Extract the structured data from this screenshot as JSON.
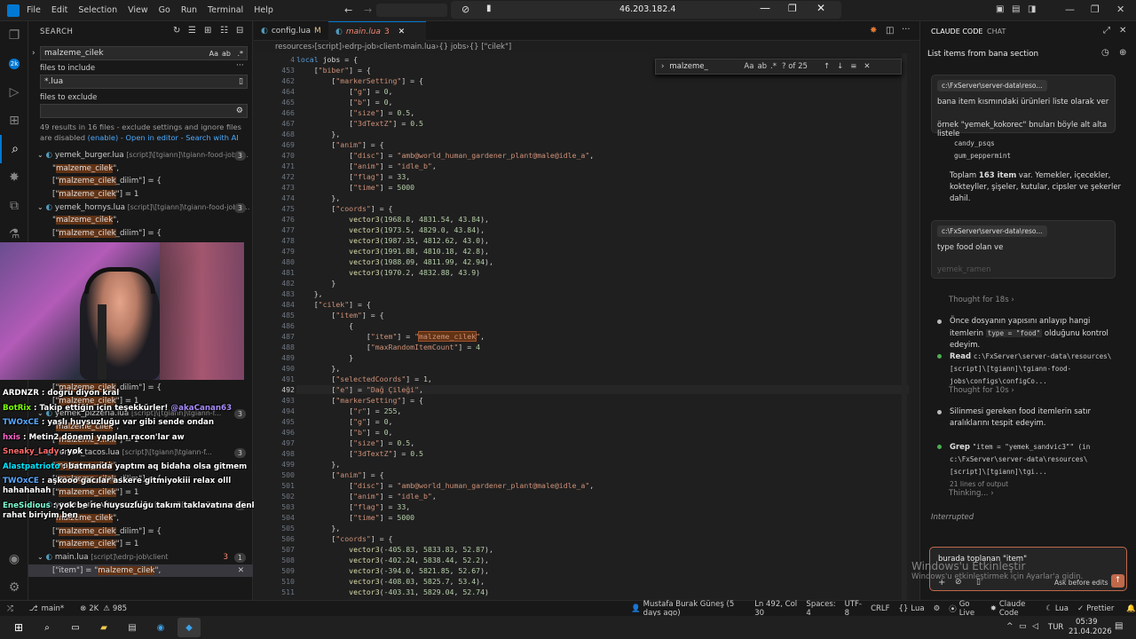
{
  "menu": [
    "File",
    "Edit",
    "Selection",
    "View",
    "Go",
    "Run",
    "Terminal",
    "Help"
  ],
  "remote_ip": "46.203.182.4",
  "search": {
    "header": "SEARCH",
    "query": "malzeme_cilek",
    "include_label": "files to include",
    "include_value": "*.lua",
    "exclude_label": "files to exclude",
    "summary": "49 results in 16 files - exclude settings and ignore files are disabled",
    "enable": "(enable)",
    "open_editor": "Open in editor",
    "search_ai": "Search with AI",
    "results": [
      {
        "type": "file",
        "name": "yemek_burger.lua",
        "path": "[script]\\[tgiann]\\tgiann-food-jobs\\...",
        "count": "3"
      },
      {
        "type": "match",
        "text": "\"malzeme_cilek\","
      },
      {
        "type": "match",
        "text": "[\"malzeme_cilek_dilim\"] = {"
      },
      {
        "type": "match",
        "text": "[\"malzeme_cilek\"] = 1"
      },
      {
        "type": "file",
        "name": "yemek_hornys.lua",
        "path": "[script]\\[tgiann]\\tgiann-food-jobs\\...",
        "count": "3"
      },
      {
        "type": "match",
        "text": "\"malzeme_cilek\","
      },
      {
        "type": "match",
        "text": "[\"malzeme_cilek_dilim\"] = {"
      }
    ],
    "results_bottom": [
      {
        "type": "match",
        "text": "[\"malzeme_cilek_dilim\"] = {"
      },
      {
        "type": "match",
        "text": "[\"malzeme_cilek\"] = 1"
      },
      {
        "type": "file",
        "name": "yemek_pizzeria.lua",
        "path": "[script]\\[tgiann]\\tgiann-f...",
        "count": "3"
      },
      {
        "type": "match",
        "text": "\"malzeme_cilek\","
      },
      {
        "type": "match",
        "text": "[\"malzeme_cilek\"] = 1"
      },
      {
        "type": "file",
        "name": "yemek_tacos.lua",
        "path": "[script]\\[tgiann]\\tgiann-f...",
        "count": "3"
      },
      {
        "type": "match",
        "text": "\"malzeme_cilek\","
      },
      {
        "type": "match",
        "text": "[\"malzeme_cilek_dilim\"] = {"
      },
      {
        "type": "match",
        "text": "[\"malzeme_cilek\"] = 1"
      },
      {
        "type": "file",
        "name": "yemek_ufo_vinewood.lua",
        "path": "[script]\\[tgiann]\\tgiann-foo...",
        "count": "3"
      },
      {
        "type": "match",
        "text": "\"malzeme_cilek\","
      },
      {
        "type": "match",
        "text": "[\"malzeme_cilek_dilim\"] = {"
      },
      {
        "type": "match",
        "text": "[\"malzeme_cilek\"] = 1"
      },
      {
        "type": "file",
        "name": "main.lua",
        "path": "[script]\\edrp-job\\client",
        "count": "1",
        "errors": "3"
      },
      {
        "type": "match",
        "text": "[\"item\"] = \"malzeme_cilek\","
      }
    ]
  },
  "chat": [
    {
      "user": "ARDNZR",
      "color": "#ffffff",
      "msg": "doğru diyon kral"
    },
    {
      "user": "BotRix",
      "color": "#7cfc00",
      "msg": "Takip ettiğin için teşekkürler!",
      "mention": "@akaCanan63"
    },
    {
      "user": "TWOxCE",
      "color": "#5aa9ff",
      "msg": "yaşlı huysuzluğu var gibi sende ondan"
    },
    {
      "user": "hxis",
      "color": "#ff66cc",
      "msg": "Metin2 dönemi yapılan racon'lar aw"
    },
    {
      "user": "Sneaky_Lady",
      "color": "#ff6a6a",
      "msg": "yok"
    },
    {
      "user": "Alastpatrioto",
      "color": "#00e5ff",
      "msg": "batmanda yaptım aq bidaha olsa gitmem"
    },
    {
      "user": "TWOxCE",
      "color": "#5aa9ff",
      "msg": "aşkooo gacılar askere gitmiyokiii relax olll hahahahah"
    },
    {
      "user": "EneSidious",
      "color": "#7fffd4",
      "msg": "yok be ne huysuzluğu takım taklavatına denk rahat biriyim ben"
    }
  ],
  "tabs": [
    {
      "name": "config.lua",
      "suffix": "M",
      "active": false
    },
    {
      "name": "main.lua",
      "suffix": "3",
      "active": true
    }
  ],
  "breadcrumbs": [
    "resources",
    "[script]",
    "edrp-job",
    "client",
    "main.lua",
    "{} jobs",
    "{} [\"cilek\"]"
  ],
  "find": {
    "query": "malzeme_",
    "count": "? of 25"
  },
  "code_lines": [
    {
      "n": "4",
      "t": "local jobs = {"
    },
    {
      "n": "453",
      "t": "    [\"biber\"] = {"
    },
    {
      "n": "462",
      "t": "        [\"markerSetting\"] = {"
    },
    {
      "n": "464",
      "t": "            [\"g\"] = 0,"
    },
    {
      "n": "465",
      "t": "            [\"b\"] = 0,"
    },
    {
      "n": "466",
      "t": "            [\"size\"] = 0.5,"
    },
    {
      "n": "467",
      "t": "            [\"3dTextZ\"] = 0.5"
    },
    {
      "n": "468",
      "t": "        },"
    },
    {
      "n": "469",
      "t": "        [\"anim\"] = {"
    },
    {
      "n": "470",
      "t": "            [\"disc\"] = \"amb@world_human_gardener_plant@male@idle_a\","
    },
    {
      "n": "471",
      "t": "            [\"anim\"] = \"idle_b\","
    },
    {
      "n": "472",
      "t": "            [\"flag\"] = 33,"
    },
    {
      "n": "473",
      "t": "            [\"time\"] = 5000"
    },
    {
      "n": "474",
      "t": "        },"
    },
    {
      "n": "475",
      "t": "        [\"coords\"] = {"
    },
    {
      "n": "476",
      "t": "            vector3(1968.8, 4831.54, 43.84),"
    },
    {
      "n": "477",
      "t": "            vector3(1973.5, 4829.0, 43.84),"
    },
    {
      "n": "478",
      "t": "            vector3(1987.35, 4812.62, 43.0),"
    },
    {
      "n": "479",
      "t": "            vector3(1991.88, 4810.18, 42.8),"
    },
    {
      "n": "480",
      "t": "            vector3(1988.09, 4811.99, 42.94),"
    },
    {
      "n": "481",
      "t": "            vector3(1970.2, 4832.88, 43.9)"
    },
    {
      "n": "482",
      "t": "        }"
    },
    {
      "n": "483",
      "t": "    },"
    },
    {
      "n": "484",
      "t": "    [\"cilek\"] = {"
    },
    {
      "n": "485",
      "t": "        [\"item\"] = {"
    },
    {
      "n": "486",
      "t": "            {"
    },
    {
      "n": "487",
      "t": "                [\"item\"] = \"malzeme_cilek\","
    },
    {
      "n": "488",
      "t": "                [\"maxRandomItemCount\"] = 4"
    },
    {
      "n": "489",
      "t": "            }"
    },
    {
      "n": "490",
      "t": "        },"
    },
    {
      "n": "491",
      "t": "        [\"selectedCoords\"] = 1,"
    },
    {
      "n": "492",
      "t": "        [\"e\"] = \"Dağ Çileği\","
    },
    {
      "n": "493",
      "t": "        [\"markerSetting\"] = {"
    },
    {
      "n": "494",
      "t": "            [\"r\"] = 255,"
    },
    {
      "n": "495",
      "t": "            [\"g\"] = 0,"
    },
    {
      "n": "496",
      "t": "            [\"b\"] = 0,"
    },
    {
      "n": "497",
      "t": "            [\"size\"] = 0.5,"
    },
    {
      "n": "498",
      "t": "            [\"3dTextZ\"] = 0.5"
    },
    {
      "n": "499",
      "t": "        },"
    },
    {
      "n": "500",
      "t": "        [\"anim\"] = {"
    },
    {
      "n": "501",
      "t": "            [\"disc\"] = \"amb@world_human_gardener_plant@male@idle_a\","
    },
    {
      "n": "502",
      "t": "            [\"anim\"] = \"idle_b\","
    },
    {
      "n": "503",
      "t": "            [\"flag\"] = 33,"
    },
    {
      "n": "504",
      "t": "            [\"time\"] = 5000"
    },
    {
      "n": "505",
      "t": "        },"
    },
    {
      "n": "506",
      "t": "        [\"coords\"] = {"
    },
    {
      "n": "507",
      "t": "            vector3(-405.83, 5833.83, 52.87),"
    },
    {
      "n": "508",
      "t": "            vector3(-402.24, 5838.44, 52.2),"
    },
    {
      "n": "509",
      "t": "            vector3(-394.0, 5821.85, 52.67),"
    },
    {
      "n": "510",
      "t": "            vector3(-408.03, 5825.7, 53.4),"
    },
    {
      "n": "511",
      "t": "            vector3(-403.31, 5829.04, 52.74)"
    },
    {
      "n": "512",
      "t": "        }"
    }
  ],
  "panel": {
    "tabs": [
      "CLAUDE CODE",
      "CHAT"
    ],
    "title": "List items from bana section",
    "msg1_chip": "c:\\FxServer\\server-data\\reso...",
    "msg1_line1": "bana item kısmındaki ürünleri liste olarak ver",
    "msg1_line2": "örnek \"yemek_kokorec\" bnuları böyle alt alta listele",
    "code1": "candy_psqs",
    "code2": "gum_peppermint",
    "summary_pre": "Toplam ",
    "summary_bold": "163 item",
    "summary_post": " var. Yemekler, içecekler, kokteyller, şişeler, kutular, cipsler ve şekerler dahil.",
    "msg2_chip": "c:\\FxServer\\server-data\\reso...",
    "msg2_line1": "type food olan ve",
    "msg2_line2": "yemek_ramen",
    "thought1": "Thought for 18s",
    "step1_pre": "Önce dosyanın yapısını anlayıp hangi itemlerin ",
    "step1_code": "type = \"food\"",
    "step1_post": " olduğunu kontrol edeyim.",
    "read_label": "Read",
    "read_path": "c:\\FxServer\\server-data\\resources\\[script]\\[tgiann]\\tgiann-food-jobs\\configs\\configCo...",
    "thought2": "Thought for 10s",
    "step2": "Silinmesi gereken food itemlerin satır aralıklarını tespit edeyim.",
    "grep_label": "Grep",
    "grep_text": "\"item = \"yemek_sandvic3\"\" (in c:\\FxServer\\server-data\\resources\\[script]\\[tgiann]\\tgi...",
    "grep_sub": "21 lines of output",
    "thinking": "Thinking...",
    "interrupted": "Interrupted",
    "input_value": "burada toplanan \"item\"",
    "ask_label": "Ask before edits",
    "watermark1": "Windows'u Etkinleştir",
    "watermark2": "Windows'u etkinleştirmek için Ayarlar'a gidin."
  },
  "status": {
    "branch": "main*",
    "errors": "2K",
    "warnings": "985",
    "blame": "Mustafa Burak Güneş (5 days ago)",
    "position": "Ln 492, Col 30",
    "spaces": "Spaces: 4",
    "encoding": "UTF-8",
    "eol": "CRLF",
    "language": "Lua",
    "golive": "Go Live",
    "claude": "Claude Code",
    "lua2": "Lua",
    "prettier": "Prettier"
  },
  "taskbar": {
    "lang": "TUR",
    "time": "05:39",
    "date": "21.04.2026"
  },
  "colors": {
    "accent": "#0078d4",
    "highlight": "#623315"
  }
}
